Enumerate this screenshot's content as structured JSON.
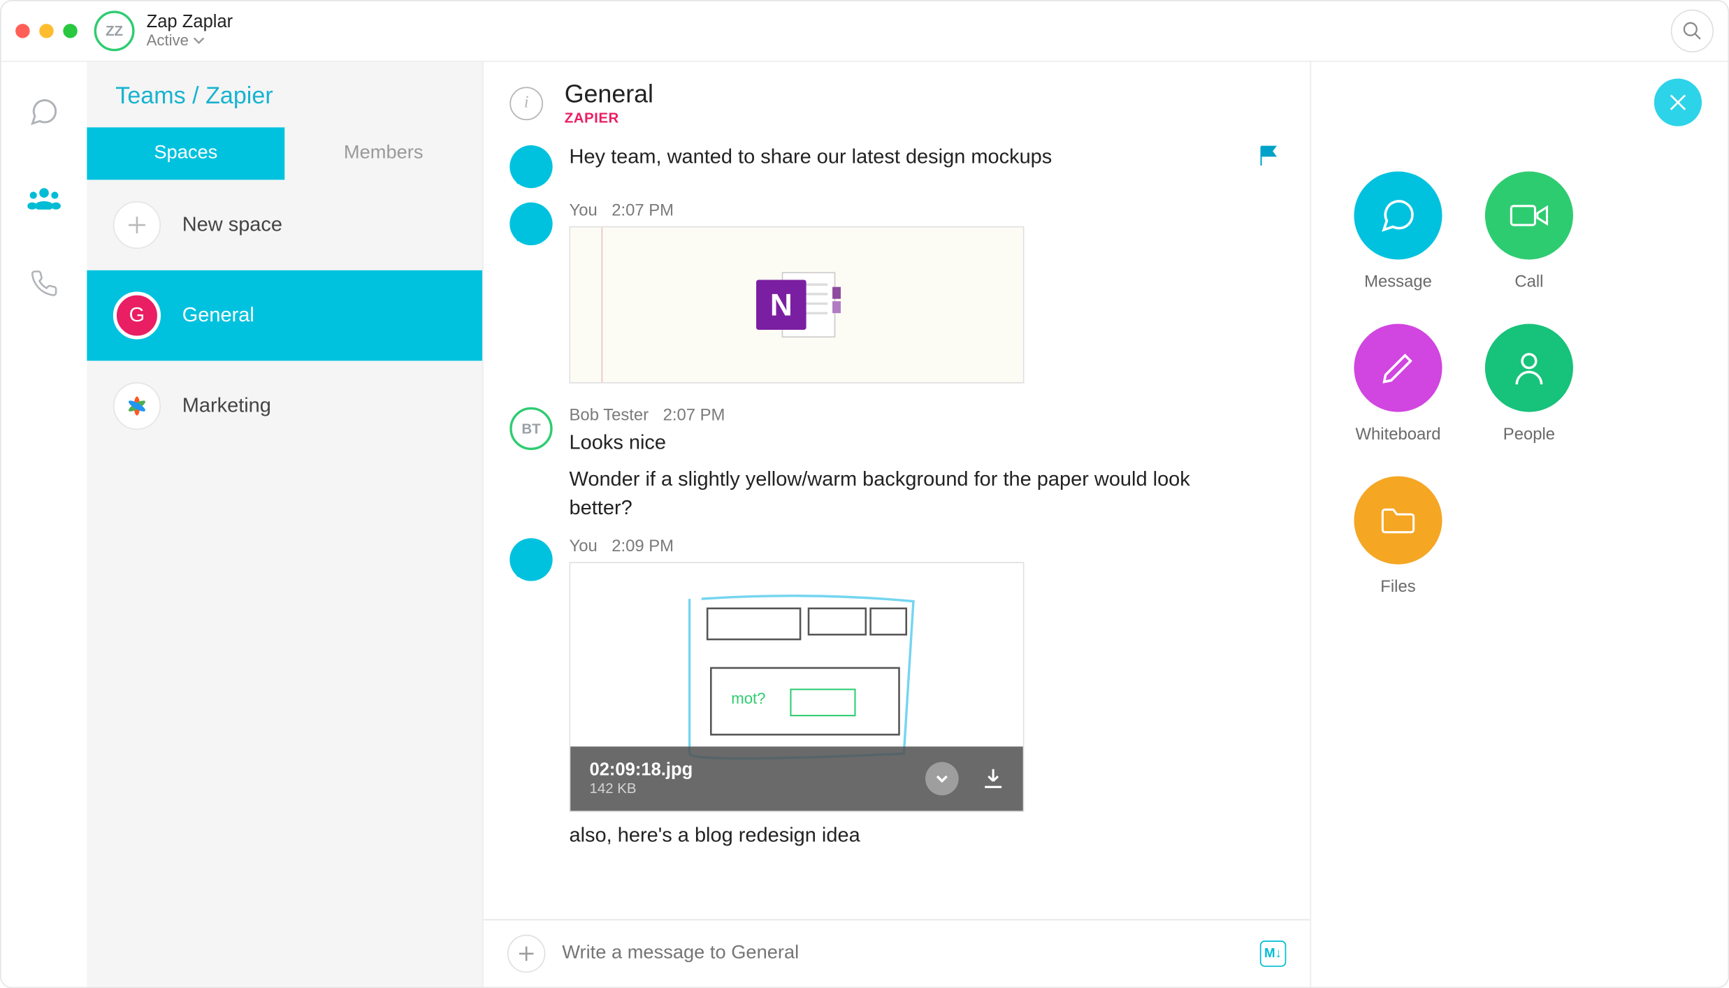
{
  "titlebar": {
    "avatar_initials": "ZZ",
    "user_name": "Zap Zaplar",
    "status": "Active"
  },
  "sidebar": {
    "breadcrumb": "Teams / Zapier",
    "tabs": {
      "spaces": "Spaces",
      "members": "Members"
    },
    "new_space": "New space",
    "spaces": [
      {
        "initial": "G",
        "label": "General"
      },
      {
        "initial": "✱",
        "label": "Marketing"
      }
    ]
  },
  "main": {
    "room_title": "General",
    "room_team": "ZAPIER",
    "messages": [
      {
        "avatar": "self",
        "text": "Hey team, wanted to share our latest design mockups",
        "flag": true
      },
      {
        "avatar": "self",
        "sender": "You",
        "time": "2:07 PM",
        "attachment": "onenote"
      },
      {
        "avatar": "bt",
        "initials": "BT",
        "sender": "Bob Tester",
        "time": "2:07 PM",
        "text": "Looks nice",
        "text2": "Wonder if a slightly yellow/warm background for the paper would look better?"
      },
      {
        "avatar": "self",
        "sender": "You",
        "time": "2:09 PM",
        "attachment": "sketch",
        "file_name": "02:09:18.jpg",
        "file_size": "142 KB",
        "text_after": "also, here's a blog redesign idea"
      }
    ],
    "compose_placeholder": "Write a message to General"
  },
  "panel": {
    "actions": {
      "message": "Message",
      "call": "Call",
      "whiteboard": "Whiteboard",
      "people": "People",
      "files": "Files"
    }
  }
}
